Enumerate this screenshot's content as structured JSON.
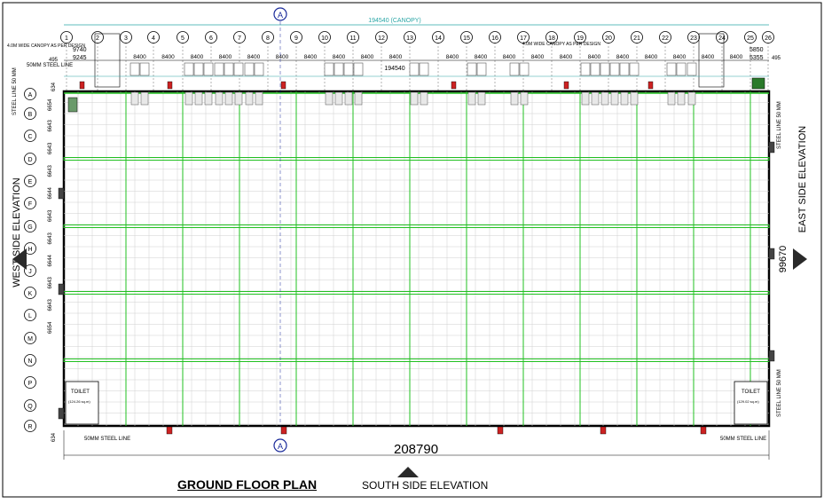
{
  "drawing": {
    "title": "GROUND FLOOR PLAN",
    "south_elevation": "SOUTH SIDE ELEVATION",
    "west_elevation": "WEST SIDE ELEVATION",
    "east_elevation": "EAST SIDE ELEVATION",
    "section_marker": "A",
    "canopy_dim": "194540 (CANOPY)",
    "inner_dim": "194540",
    "overall_width": "208790",
    "overall_depth": "99670",
    "canopy_note_left": "4.0M WIDE CANOPY AS PER DESIGN",
    "canopy_note_right": "4.0M WIDE CANOPY AS PER DESIGN",
    "steel_line_50": "50MM STEEL LINE",
    "steel_line_side": "STEEL LINE 50 MM",
    "toilet_left": {
      "label": "TOILET",
      "area": "(124.26 sq.m)"
    },
    "toilet_right": {
      "label": "TOILET",
      "area": "(129.02 sq.m)"
    },
    "left_dims_top": [
      "9740",
      "9245",
      "495"
    ],
    "right_dims_top": [
      "5850",
      "5355",
      "495"
    ],
    "bay_dim": "8400",
    "left_small_dims": [
      "634",
      "6654",
      "6643",
      "6643",
      "6643",
      "6644",
      "6643",
      "6643",
      "6644",
      "6643",
      "6643",
      "6654",
      "634"
    ]
  },
  "grid": {
    "columns": [
      "1",
      "2",
      "3",
      "4",
      "5",
      "6",
      "7",
      "8",
      "9",
      "10",
      "11",
      "12",
      "13",
      "14",
      "15",
      "16",
      "17",
      "18",
      "19",
      "20",
      "21",
      "22",
      "23",
      "24",
      "25",
      "26"
    ],
    "rows": [
      "A",
      "B",
      "C",
      "D",
      "E",
      "F",
      "G",
      "H",
      "J",
      "K",
      "L",
      "M",
      "N",
      "P",
      "Q",
      "R"
    ]
  },
  "colors": {
    "grid_line": "#22c022",
    "wall": "#000000",
    "dim_line": "#2aa6a6",
    "marker": "#1a2a9a",
    "door_red": "#cc2222"
  }
}
